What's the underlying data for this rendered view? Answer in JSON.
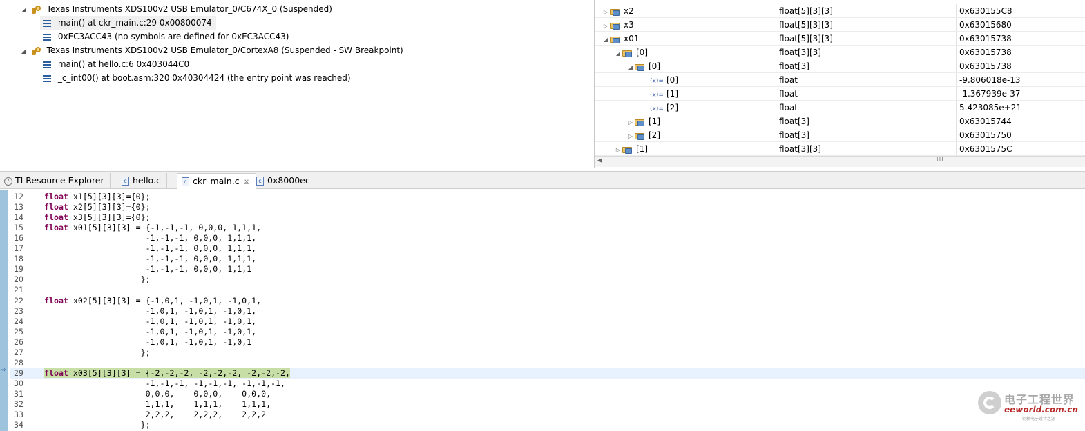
{
  "debug": {
    "rows": [
      {
        "type": "thread",
        "label": "Texas Instruments XDS100v2 USB Emulator_0/C674X_0 (Suspended)"
      },
      {
        "type": "frame",
        "label": "main() at ckr_main.c:29 0x00800074"
      },
      {
        "type": "frame",
        "label": "0xEC3ACC43  (no symbols are defined for 0xEC3ACC43)"
      },
      {
        "type": "thread",
        "label": "Texas Instruments XDS100v2 USB Emulator_0/CortexA8 (Suspended - SW Breakpoint)"
      },
      {
        "type": "frame",
        "label": "main() at hello.c:6 0x403044C0"
      },
      {
        "type": "frame",
        "label": "_c_int00() at boot.asm:320 0x40304424  (the entry point was reached)"
      }
    ]
  },
  "variables": {
    "rows": [
      {
        "name": "x2",
        "type": "float[5][3][3]",
        "value": "0x630155C8"
      },
      {
        "name": "x3",
        "type": "float[5][3][3]",
        "value": "0x63015680"
      },
      {
        "name": "x01",
        "type": "float[5][3][3]",
        "value": "0x63015738"
      },
      {
        "name": "[0]",
        "type": "float[3][3]",
        "value": "0x63015738"
      },
      {
        "name": "[0]",
        "type": "float[3]",
        "value": "0x63015738"
      },
      {
        "name": "[0]",
        "type": "float",
        "value": "-9.806018e-13"
      },
      {
        "name": "[1]",
        "type": "float",
        "value": "-1.367939e-37"
      },
      {
        "name": "[2]",
        "type": "float",
        "value": "5.423085e+21"
      },
      {
        "name": "[1]",
        "type": "float[3]",
        "value": "0x63015744"
      },
      {
        "name": "[2]",
        "type": "float[3]",
        "value": "0x63015750"
      },
      {
        "name": "[1]",
        "type": "float[3][3]",
        "value": "0x6301575C"
      }
    ],
    "scroll_grip": "III",
    "var_glyph": "(x)="
  },
  "tabs": [
    {
      "label": "TI Resource Explorer",
      "icon": "ti-icon"
    },
    {
      "label": "hello.c",
      "icon": "c-file-icon"
    },
    {
      "label": "ckr_main.c",
      "icon": "c-file-icon",
      "active": true
    },
    {
      "label": "0x8000ec",
      "icon": "c-file-icon"
    }
  ],
  "editor": {
    "current_line": "29",
    "lines": [
      {
        "n": "12",
        "kw": "float",
        "text": " x1[5][3][3]={0};"
      },
      {
        "n": "13",
        "kw": "float",
        "text": " x2[5][3][3]={0};"
      },
      {
        "n": "14",
        "kw": "float",
        "text": " x3[5][3][3]={0};"
      },
      {
        "n": "15",
        "kw": "float",
        "text": " x01[5][3][3] = {-1,-1,-1, 0,0,0, 1,1,1,"
      },
      {
        "n": "16",
        "kw": "",
        "text": "                     -1,-1,-1, 0,0,0, 1,1,1,"
      },
      {
        "n": "17",
        "kw": "",
        "text": "                     -1,-1,-1, 0,0,0, 1,1,1,"
      },
      {
        "n": "18",
        "kw": "",
        "text": "                     -1,-1,-1, 0,0,0, 1,1,1,"
      },
      {
        "n": "19",
        "kw": "",
        "text": "                     -1,-1,-1, 0,0,0, 1,1,1"
      },
      {
        "n": "20",
        "kw": "",
        "text": "                    };"
      },
      {
        "n": "21",
        "kw": "",
        "text": ""
      },
      {
        "n": "22",
        "kw": "float",
        "text": " x02[5][3][3] = {-1,0,1, -1,0,1, -1,0,1,"
      },
      {
        "n": "23",
        "kw": "",
        "text": "                     -1,0,1, -1,0,1, -1,0,1,"
      },
      {
        "n": "24",
        "kw": "",
        "text": "                     -1,0,1, -1,0,1, -1,0,1,"
      },
      {
        "n": "25",
        "kw": "",
        "text": "                     -1,0,1, -1,0,1, -1,0,1,"
      },
      {
        "n": "26",
        "kw": "",
        "text": "                     -1,0,1, -1,0,1, -1,0,1"
      },
      {
        "n": "27",
        "kw": "",
        "text": "                    };"
      },
      {
        "n": "28",
        "kw": "",
        "text": ""
      },
      {
        "n": "29",
        "kw": "float",
        "text": " x03[5][3][3] = {-2,-2,-2, -2,-2,-2, -2,-2,-2,"
      },
      {
        "n": "30",
        "kw": "",
        "text": "                     -1,-1,-1, -1,-1,-1, -1,-1,-1,"
      },
      {
        "n": "31",
        "kw": "",
        "text": "                     0,0,0,    0,0,0,    0,0,0,"
      },
      {
        "n": "32",
        "kw": "",
        "text": "                     1,1,1,    1,1,1,    1,1,1,"
      },
      {
        "n": "33",
        "kw": "",
        "text": "                     2,2,2,    2,2,2,    2,2,2"
      },
      {
        "n": "34",
        "kw": "",
        "text": "                    };"
      }
    ]
  },
  "watermark": {
    "cn": "电子工程世界",
    "en": "eeworld.com.cn",
    "tagline": "创新电子设计之源"
  },
  "colors": {
    "keyword": "#7f0055",
    "current_line_bg": "#e8f2fe",
    "current_line_code_bg": "#c7dfa6",
    "ruler": "#9ec4dd"
  }
}
